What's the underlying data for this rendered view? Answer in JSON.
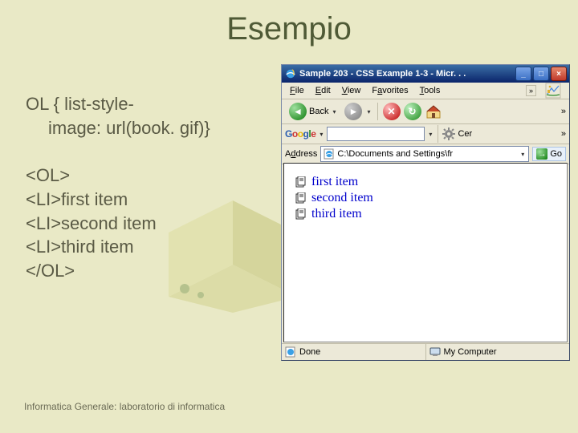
{
  "title": "Esempio",
  "code_block1_line1": "OL { list-style-",
  "code_block1_line2": "image: url(book. gif)}",
  "code_block2_line1": "<OL>",
  "code_block2_line2": "<LI>first item",
  "code_block2_line3": "<LI>second item",
  "code_block2_line4": "<LI>third item",
  "code_block2_line5": "</OL>",
  "footer": "Informatica Generale: laboratorio di informatica",
  "browser": {
    "titlebar": "Sample 203 - CSS Example 1-3 - Micr. . .",
    "menu": {
      "file": "File",
      "edit": "Edit",
      "view": "View",
      "favorites": "Favorites",
      "tools": "Tools",
      "more": "»"
    },
    "toolbar": {
      "back": "Back",
      "more": "»"
    },
    "google": {
      "brand": "Google",
      "cer": "Cer",
      "more": "»"
    },
    "address_label": "Address",
    "address_value": "C:\\Documents and Settings\\fr",
    "go": "Go",
    "items": [
      "first item",
      "second item",
      "third item"
    ],
    "status_done": "Done",
    "status_zone": "My Computer"
  }
}
